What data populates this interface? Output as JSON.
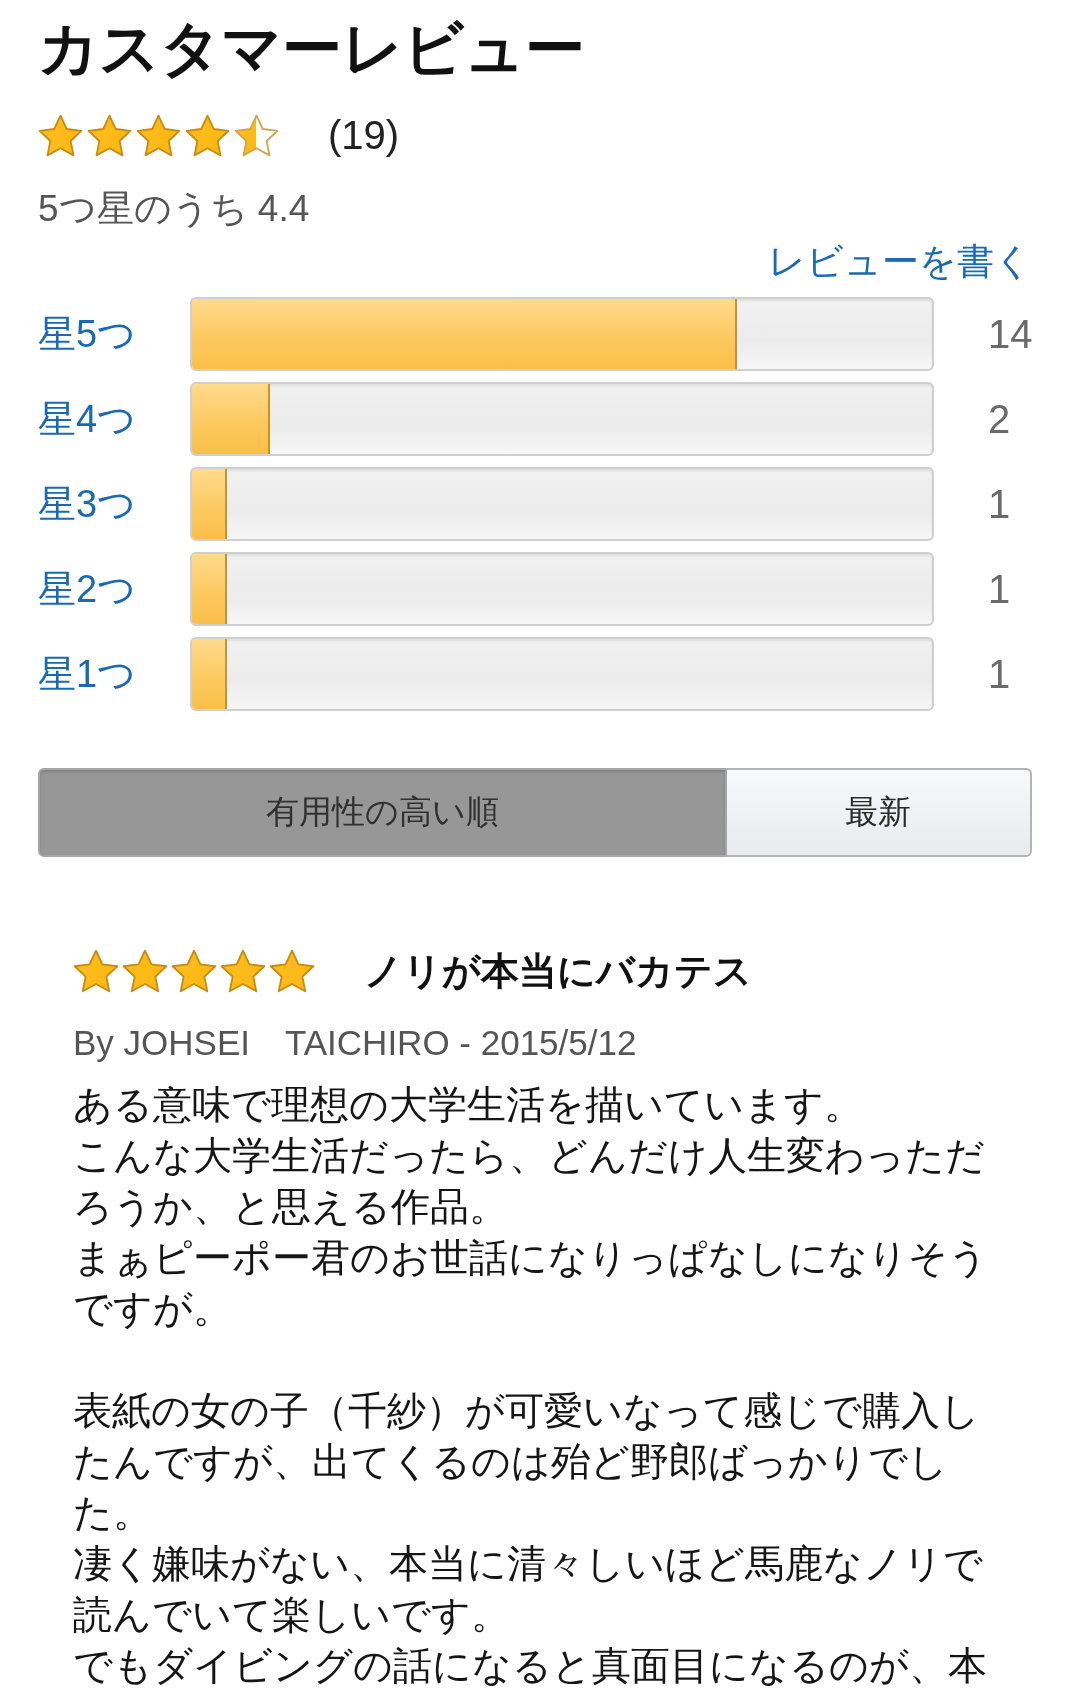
{
  "header": {
    "title": "カスタマーレビュー"
  },
  "summary": {
    "stars": 4.5,
    "count": "(19)",
    "rating_text": "5つ星のうち 4.4",
    "write_review_link": "レビューを書く"
  },
  "histogram": [
    {
      "label": "星5つ",
      "level": 0.737,
      "count": "14"
    },
    {
      "label": "星4つ",
      "level": 0.105,
      "count": "2"
    },
    {
      "label": "星3つ",
      "level": 0.047,
      "count": "1"
    },
    {
      "label": "星2つ",
      "level": 0.047,
      "count": "1"
    },
    {
      "label": "星1つ",
      "level": 0.047,
      "count": "1"
    }
  ],
  "sort_tabs": [
    {
      "label": "有用性の高い順",
      "selected": true
    },
    {
      "label": "最新",
      "selected": false
    }
  ],
  "reviews": [
    {
      "stars": 5,
      "title": "ノリが本当にバカテス",
      "byline": "By JOHSEI　TAICHIRO - 2015/5/12",
      "paragraphs": [
        [
          "ある意味で理想の大学生活を描いています。",
          "こんな大学生活だったら、どんだけ人生変わっただろうか、と思える作品。",
          "まぁピーポー君のお世話になりっぱなしになりそうですが。"
        ],
        [
          "表紙の女の子（千紗）が可愛いなって感じで購入したんですが、出てくるのは殆ど野郎ばっかりでした。",
          "凄く嫌味がない、本当に清々しいほど馬鹿なノリで読んでいて楽しいです。",
          "でもダイビングの話になると真面目になるのが、本"
        ]
      ]
    }
  ]
}
